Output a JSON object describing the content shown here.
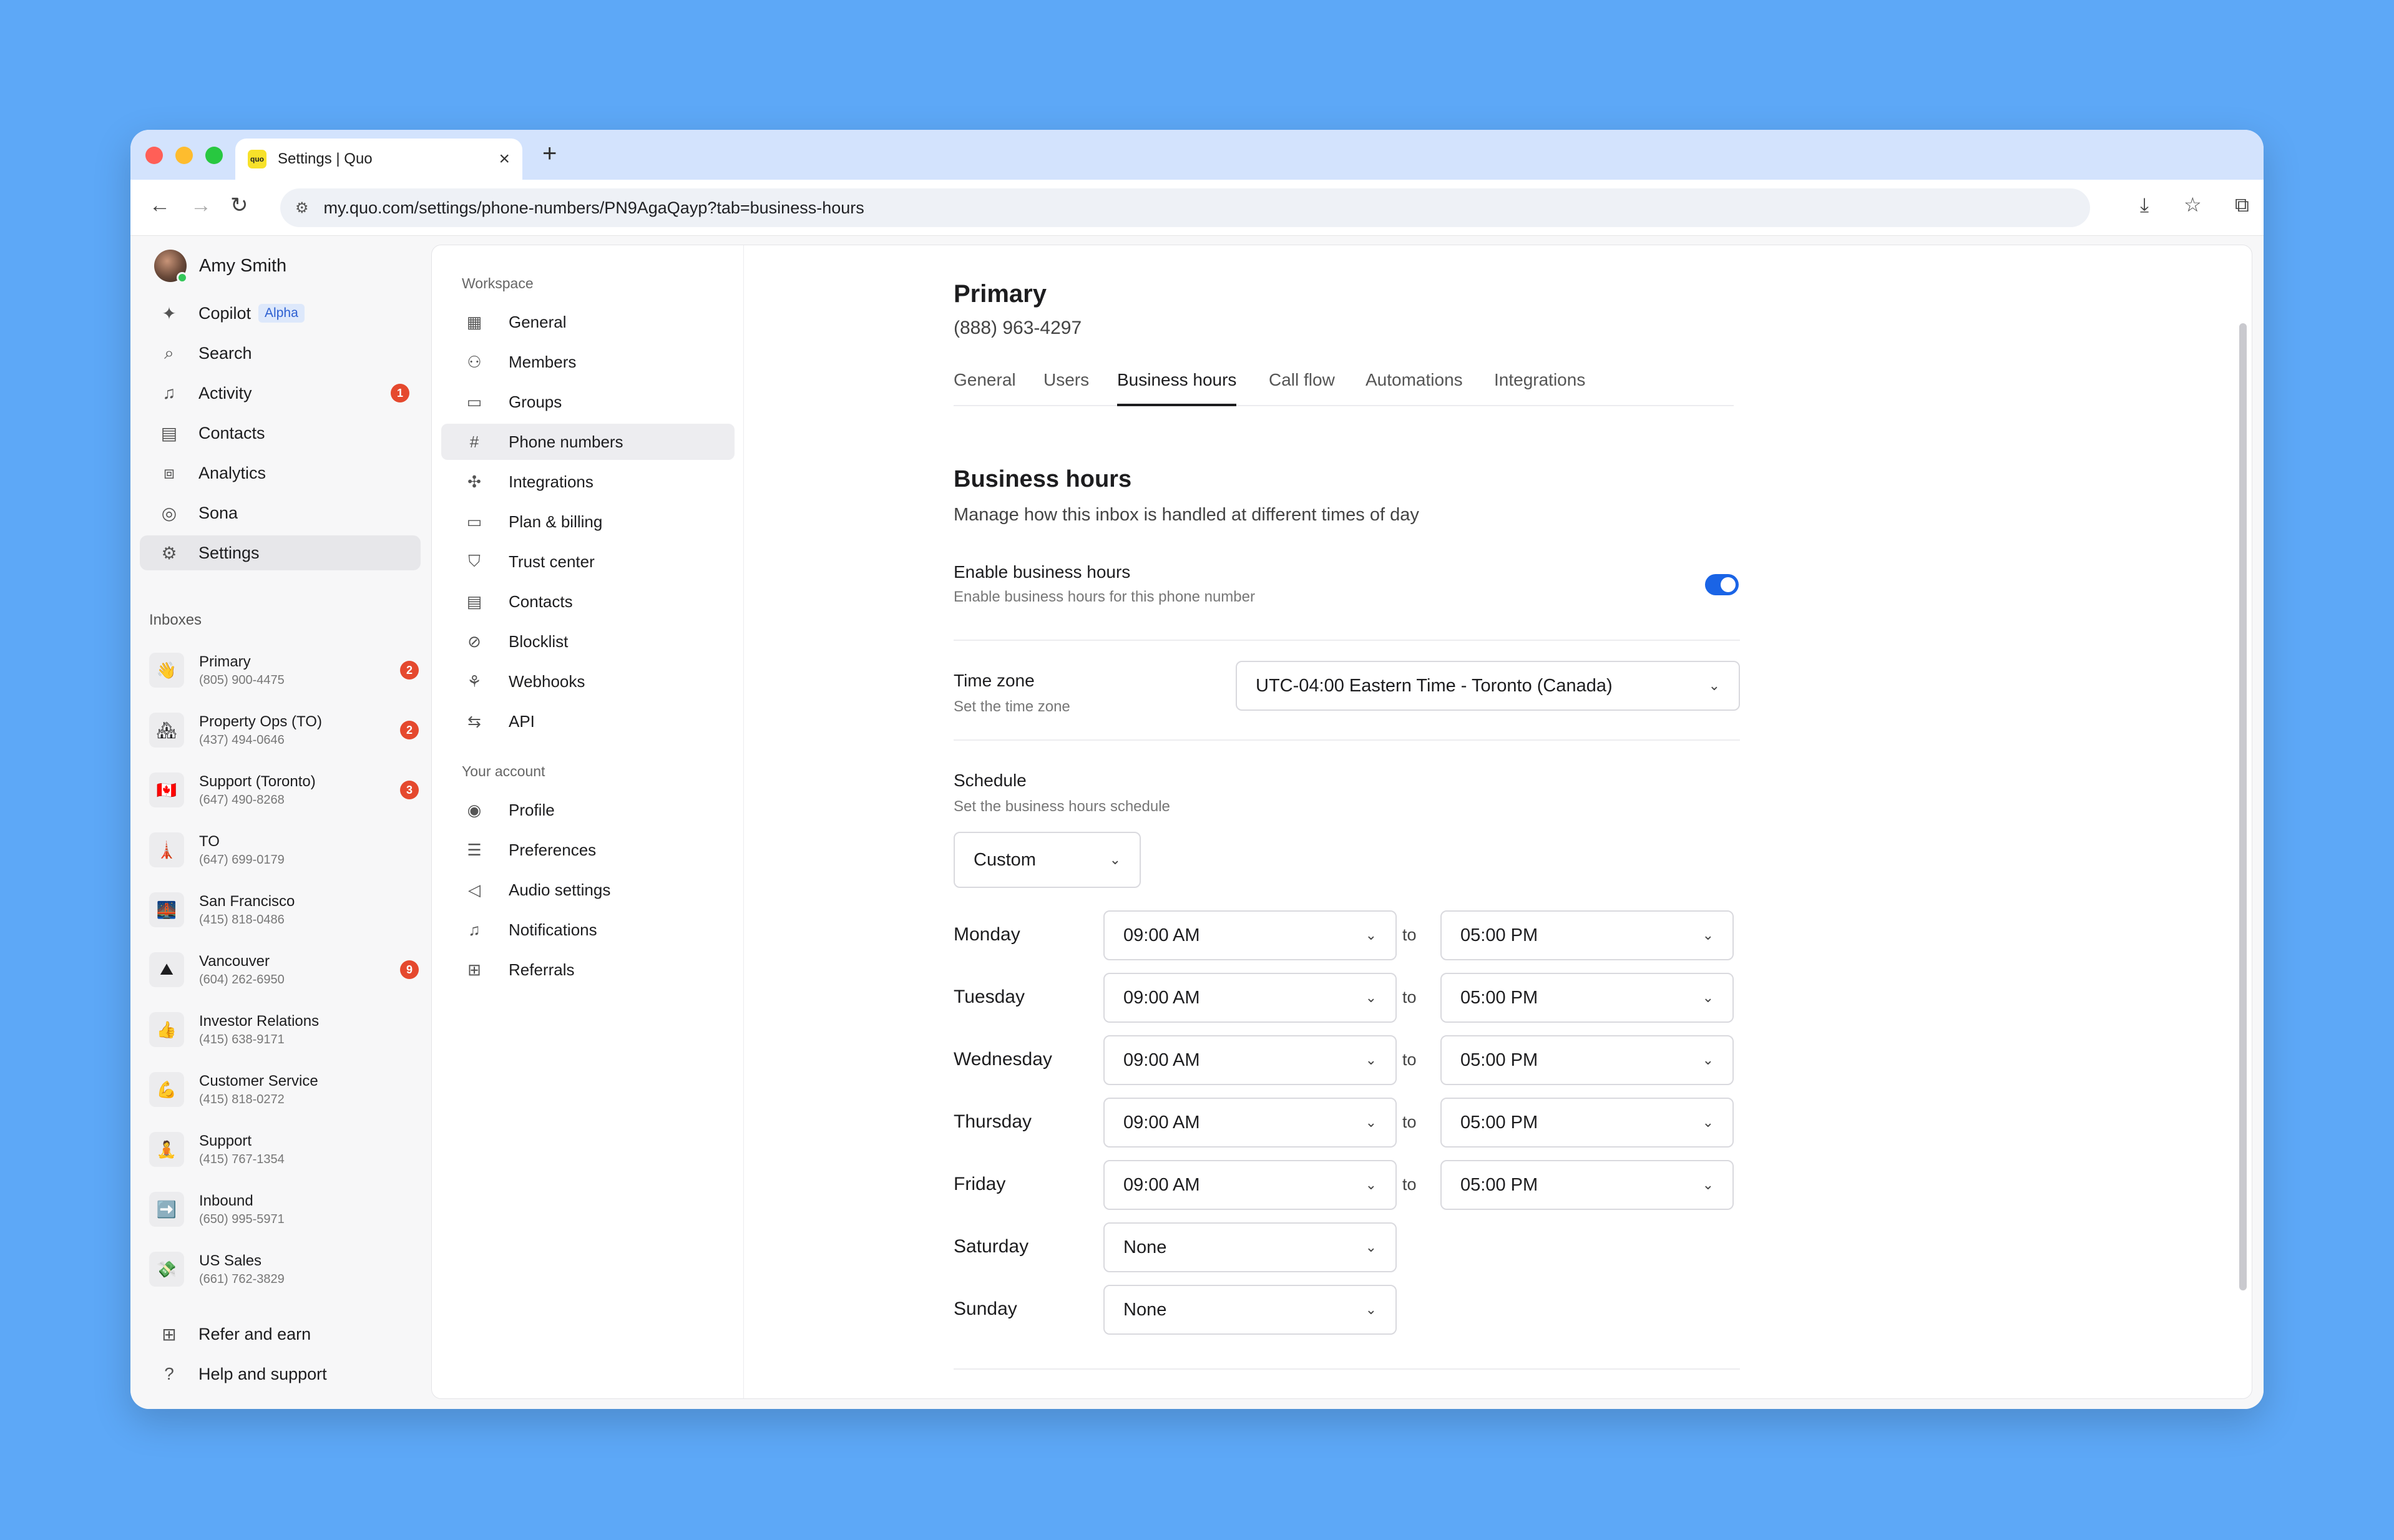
{
  "browser": {
    "tab_title": "Settings | Quo",
    "favicon_text": "quo",
    "url": "my.quo.com/settings/phone-numbers/PN9AgaQayp?tab=business-hours"
  },
  "sidebar": {
    "user_name": "Amy Smith",
    "nav": [
      {
        "label": "Copilot",
        "badge": "Alpha",
        "icon": "sparkle-icon"
      },
      {
        "label": "Search",
        "icon": "search-icon"
      },
      {
        "label": "Activity",
        "count": "1",
        "icon": "bell-icon"
      },
      {
        "label": "Contacts",
        "icon": "contacts-icon"
      },
      {
        "label": "Analytics",
        "icon": "analytics-icon"
      },
      {
        "label": "Sona",
        "icon": "sona-icon"
      },
      {
        "label": "Settings",
        "icon": "gear-icon"
      }
    ],
    "inboxes_label": "Inboxes",
    "inboxes": [
      {
        "name": "Primary",
        "number": "(805) 900-4475",
        "count": "2",
        "emoji": "👋"
      },
      {
        "name": "Property Ops (TO)",
        "number": "(437) 494-0646",
        "count": "2",
        "emoji": "🏘"
      },
      {
        "name": "Support (Toronto)",
        "number": "(647) 490-8268",
        "count": "3",
        "emoji": "🇨🇦"
      },
      {
        "name": "TO",
        "number": "(647) 699-0179",
        "emoji": "🗼"
      },
      {
        "name": "San Francisco",
        "number": "(415) 818-0486",
        "emoji": "🌉"
      },
      {
        "name": "Vancouver",
        "number": "(604) 262-6950",
        "count": "9",
        "emoji": "⛰"
      },
      {
        "name": "Investor Relations",
        "number": "(415) 638-9171",
        "emoji": "👍"
      },
      {
        "name": "Customer Service",
        "number": "(415) 818-0272",
        "emoji": "💪"
      },
      {
        "name": "Support",
        "number": "(415) 767-1354",
        "emoji": "🧘"
      },
      {
        "name": "Inbound",
        "number": "(650) 995-5971",
        "emoji": "➡️"
      },
      {
        "name": "US Sales",
        "number": "(661) 762-3829",
        "emoji": "💸"
      }
    ],
    "footer": [
      {
        "label": "Refer and earn",
        "icon": "gift-icon"
      },
      {
        "label": "Help and support",
        "icon": "help-icon"
      }
    ]
  },
  "settings_nav": {
    "workspace_header": "Workspace",
    "workspace_items": [
      "General",
      "Members",
      "Groups",
      "Phone numbers",
      "Integrations",
      "Plan & billing",
      "Trust center",
      "Contacts",
      "Blocklist",
      "Webhooks",
      "API"
    ],
    "account_header": "Your account",
    "account_items": [
      "Profile",
      "Preferences",
      "Audio settings",
      "Notifications",
      "Referrals"
    ]
  },
  "main": {
    "title": "Primary",
    "phone": "(888) 963-4297",
    "tabs": [
      "General",
      "Users",
      "Business hours",
      "Call flow",
      "Automations",
      "Integrations"
    ],
    "active_tab": "Business hours",
    "section_title": "Business hours",
    "section_desc": "Manage how this inbox is handled at different times of day",
    "enable_label": "Enable business hours",
    "enable_hint": "Enable business hours for this phone number",
    "enable_on": true,
    "timezone_label": "Time zone",
    "timezone_hint": "Set the time zone",
    "timezone_value": "UTC-04:00 Eastern Time - Toronto (Canada)",
    "schedule_label": "Schedule",
    "schedule_hint": "Set the business hours schedule",
    "schedule_value": "Custom",
    "to_label": "to",
    "days": [
      {
        "day": "Monday",
        "start": "09:00 AM",
        "end": "05:00 PM"
      },
      {
        "day": "Tuesday",
        "start": "09:00 AM",
        "end": "05:00 PM"
      },
      {
        "day": "Wednesday",
        "start": "09:00 AM",
        "end": "05:00 PM"
      },
      {
        "day": "Thursday",
        "start": "09:00 AM",
        "end": "05:00 PM"
      },
      {
        "day": "Friday",
        "start": "09:00 AM",
        "end": "05:00 PM"
      },
      {
        "day": "Saturday",
        "start": "None"
      },
      {
        "day": "Sunday",
        "start": "None"
      }
    ]
  },
  "colors": {
    "accent": "#1a64e6",
    "badge": "#e5492e",
    "background": "#5da8f7"
  }
}
